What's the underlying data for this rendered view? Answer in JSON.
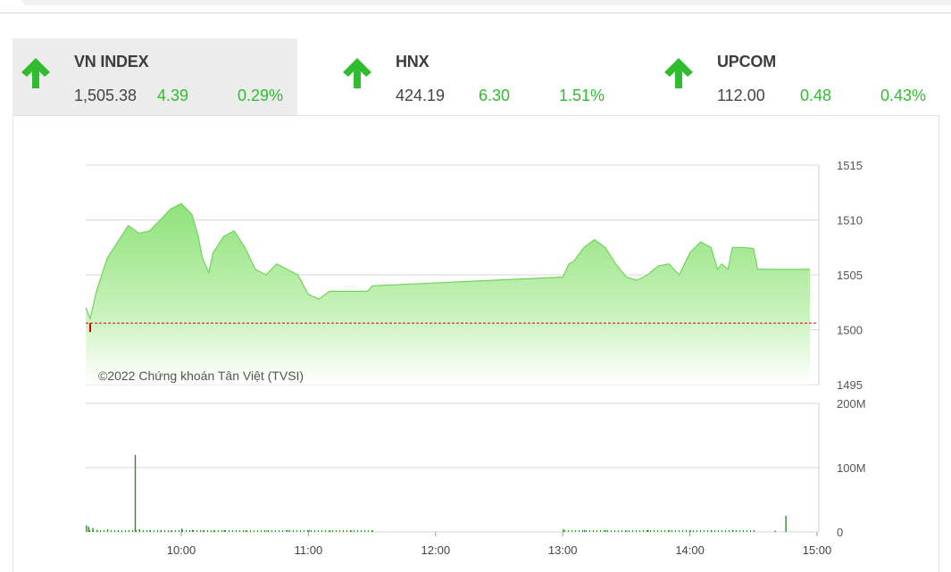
{
  "indices": [
    {
      "name": "VN INDEX",
      "value": "1,505.38",
      "change": "4.39",
      "percent": "0.29%",
      "direction": "up",
      "selected": true
    },
    {
      "name": "HNX",
      "value": "424.19",
      "change": "6.30",
      "percent": "1.51%",
      "direction": "up",
      "selected": false
    },
    {
      "name": "UPCOM",
      "value": "112.00",
      "change": "0.48",
      "percent": "0.43%",
      "direction": "up",
      "selected": false
    }
  ],
  "colors": {
    "up": "#2fbc2f",
    "area_fill": "#9fe889",
    "area_line": "#6fd45a",
    "reference_line": "#d40000",
    "volume_bar": "#2e8b2e",
    "grid": "#d9d9d9"
  },
  "copyright": "©2022 Chứng khoán Tân Việt (TVSI)",
  "chart_data": [
    {
      "type": "area",
      "ylim": [
        1495,
        1515
      ],
      "yticks": [
        "1515",
        "1510",
        "1505",
        "1500",
        "1495"
      ],
      "xticks": [
        "10:00",
        "11:00",
        "12:00",
        "13:00",
        "14:00",
        "15:00"
      ],
      "reference": 1500.6,
      "grid": true,
      "series": [
        {
          "x": [
            "09:15",
            "09:17",
            "09:20",
            "09:25",
            "09:30",
            "09:35",
            "09:40",
            "09:45",
            "09:50",
            "09:55",
            "10:00",
            "10:05",
            "10:08",
            "10:10",
            "10:13",
            "10:15",
            "10:20",
            "10:25",
            "10:30",
            "10:35",
            "10:40",
            "10:45",
            "10:50",
            "10:55",
            "11:00",
            "11:05",
            "11:10",
            "11:13",
            "11:15",
            "11:20",
            "11:25",
            "11:28",
            "11:30",
            "13:00",
            "13:03",
            "13:05",
            "13:10",
            "13:15",
            "13:20",
            "13:25",
            "13:30",
            "13:35",
            "13:40",
            "13:45",
            "13:50",
            "13:55",
            "14:00",
            "14:05",
            "14:10",
            "14:13",
            "14:15",
            "14:18",
            "14:20",
            "14:25",
            "14:30",
            "14:32",
            "14:35",
            "14:40",
            "14:45"
          ],
          "y": [
            1502.0,
            1501.0,
            1503.5,
            1506.5,
            1508.0,
            1509.5,
            1508.8,
            1509.0,
            1510.0,
            1511.0,
            1511.5,
            1510.5,
            1508.5,
            1506.5,
            1505.2,
            1507.0,
            1508.5,
            1509.0,
            1507.5,
            1505.5,
            1505.0,
            1506.0,
            1505.5,
            1505.0,
            1503.2,
            1502.8,
            1503.5,
            1503.5,
            1503.5,
            1503.5,
            1503.5,
            1503.5,
            1504.0,
            1504.8,
            1506.0,
            1506.2,
            1507.5,
            1508.2,
            1507.5,
            1506.0,
            1504.8,
            1504.5,
            1505.0,
            1505.8,
            1506.0,
            1505.0,
            1507.0,
            1508.0,
            1507.5,
            1505.5,
            1506.0,
            1505.5,
            1507.5,
            1507.5,
            1507.4,
            1505.5,
            1505.5,
            1505.5,
            1505.5
          ]
        }
      ]
    },
    {
      "type": "bar",
      "ylim": [
        0,
        200
      ],
      "yticks": [
        "200M",
        "100M",
        "0"
      ],
      "unit": "M",
      "x": [
        "09:15",
        "09:16",
        "09:18",
        "09:20",
        "09:25",
        "09:30",
        "09:35",
        "09:38",
        "09:40",
        "09:45",
        "09:50",
        "09:55",
        "10:00",
        "10:05",
        "10:10",
        "10:15",
        "10:20",
        "10:30",
        "10:40",
        "10:50",
        "11:00",
        "11:10",
        "11:20",
        "11:30",
        "13:00",
        "13:10",
        "13:20",
        "13:30",
        "13:40",
        "13:50",
        "14:00",
        "14:10",
        "14:20",
        "14:30",
        "14:40",
        "14:45"
      ],
      "values": [
        10,
        8,
        6,
        3,
        4,
        2,
        2,
        120,
        4,
        3,
        2,
        2,
        5,
        3,
        2,
        2,
        3,
        2,
        2,
        3,
        3,
        2,
        2,
        2,
        4,
        3,
        3,
        2,
        3,
        2,
        2,
        2,
        3,
        2,
        2,
        25
      ]
    }
  ]
}
